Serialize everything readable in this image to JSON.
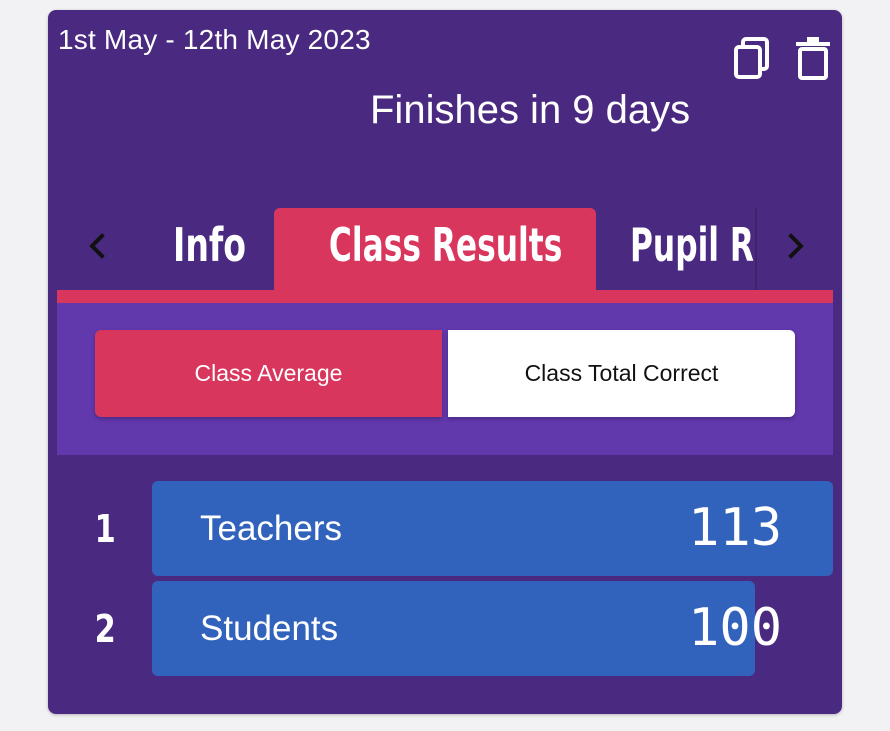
{
  "header": {
    "date_range": "1st May - 12th May 2023",
    "countdown": "Finishes in 9 days",
    "copy_icon": "copy-icon",
    "delete_icon": "trash-icon"
  },
  "tabs": {
    "items": [
      {
        "label": "Info",
        "active": false
      },
      {
        "label": "Class Results",
        "active": true
      },
      {
        "label": "Pupil Results",
        "active": false
      }
    ],
    "prev_icon": "chevron-left-icon",
    "next_icon": "chevron-right-icon"
  },
  "toggle": {
    "options": [
      "Class Average",
      "Class Total Correct"
    ],
    "selected": "Class Average"
  },
  "results": {
    "max_value": 113,
    "rows": [
      {
        "rank": "1",
        "name": "Teachers",
        "value": 113
      },
      {
        "rank": "2",
        "name": "Students",
        "value": 100
      }
    ]
  },
  "colors": {
    "card_bg": "#4a2a80",
    "accent_pink": "#d9365e",
    "panel_purple": "#6238ad",
    "bar_blue": "#3263bc"
  }
}
